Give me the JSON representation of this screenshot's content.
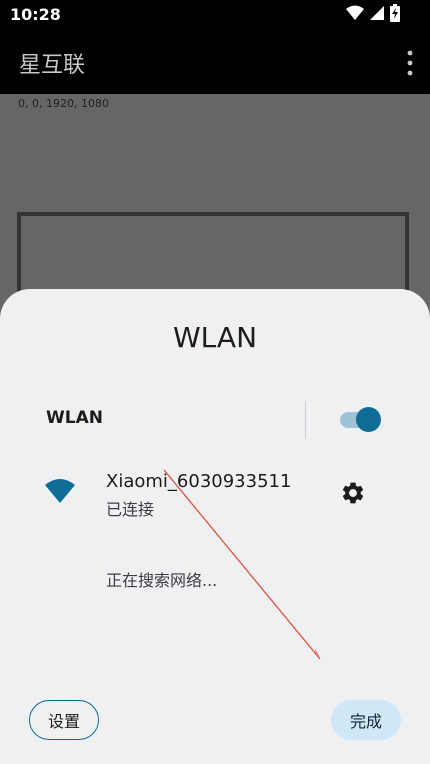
{
  "status_bar": {
    "time": "10:28",
    "icons": [
      "wifi-icon",
      "signal-icon",
      "battery-charging-icon"
    ]
  },
  "app_bar": {
    "title": "星互联",
    "menu_icon": "more-vert-icon"
  },
  "content": {
    "coords_text": "0, 0, 1920, 1080"
  },
  "dialog": {
    "title": "WLAN",
    "wlan_toggle_label": "WLAN",
    "wlan_enabled": true,
    "network": {
      "name": "Xiaomi_6030933511",
      "status": "已连接",
      "icon": "wifi-icon",
      "settings_icon": "gear-icon"
    },
    "searching_text": "正在搜索网络...",
    "settings_button": "设置",
    "done_button": "完成"
  },
  "colors": {
    "accent": "#0e6c96",
    "sheet_bg": "#eef0f2",
    "done_button_bg": "#cfe7f7",
    "annotation_arrow": "#e0503c"
  }
}
